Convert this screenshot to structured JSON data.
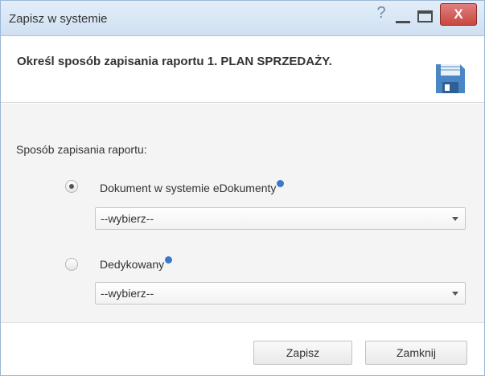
{
  "window": {
    "title": "Zapisz w systemie",
    "help_glyph": "?",
    "close_glyph": "X"
  },
  "header": {
    "heading": "Określ sposób zapisania raportu 1. PLAN SPRZEDAŻY.",
    "icon": "floppy-disk-icon"
  },
  "form": {
    "section_label": "Sposób zapisania raportu:",
    "options": [
      {
        "label": "Dokument w systemie eDokumenty",
        "selected": true,
        "select_value": "--wybierz--"
      },
      {
        "label": "Dedykowany",
        "selected": false,
        "select_value": "--wybierz--"
      }
    ]
  },
  "footer": {
    "save_label": "Zapisz",
    "close_label": "Zamknij"
  },
  "colors": {
    "titlebar": "#d7e6f5",
    "close_button": "#c9473f",
    "info_icon": "#3a78c9",
    "floppy": "#4a86c5"
  }
}
